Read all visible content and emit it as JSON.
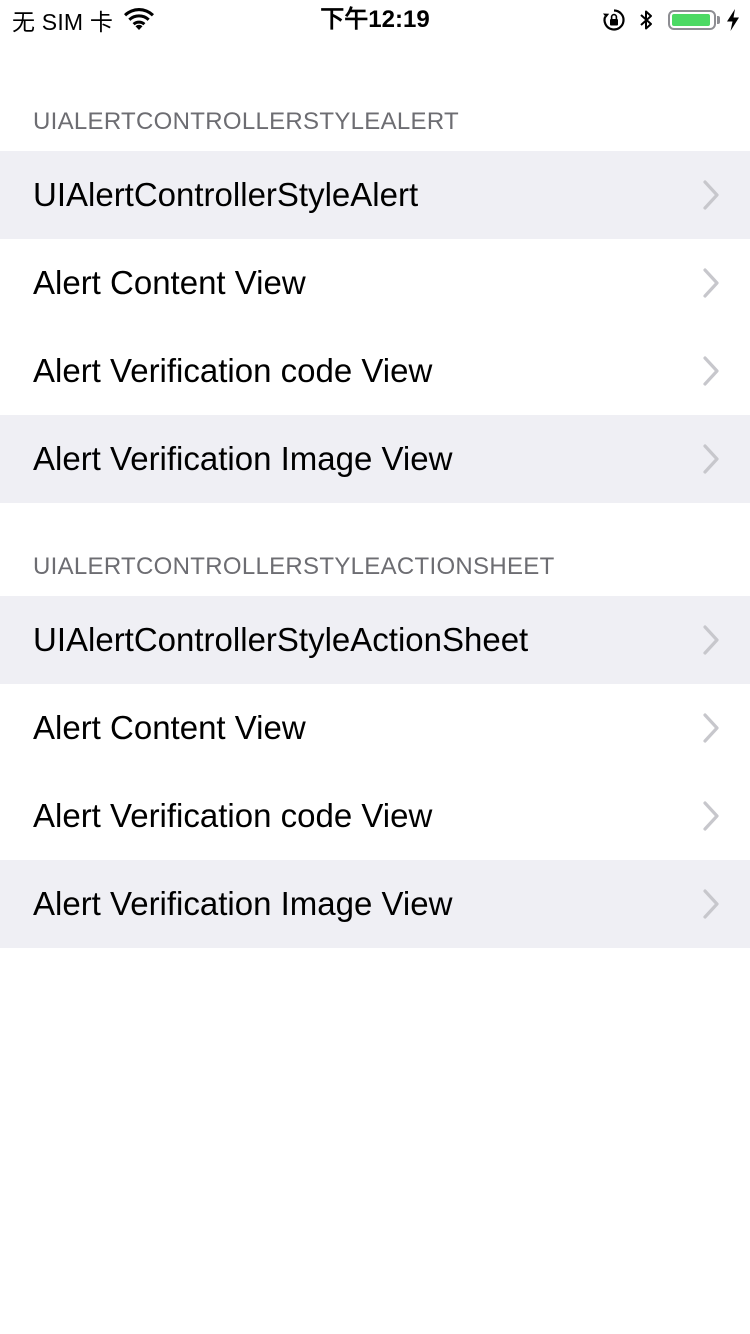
{
  "status_bar": {
    "carrier": "无 SIM 卡",
    "time": "下午12:19",
    "battery_level": 0.95,
    "icons": [
      "wifi-icon",
      "orientation-lock-icon",
      "bluetooth-icon",
      "battery-icon",
      "charging-bolt-icon"
    ]
  },
  "colors": {
    "highlight_row": "#efeff4",
    "section_header_text": "#6d6d72",
    "chevron": "#c7c7cc",
    "battery_fill": "#4cd964"
  },
  "sections": [
    {
      "header": "UIAlertControllerStyleAlert",
      "rows": [
        {
          "label": "UIAlertControllerStyleAlert",
          "highlighted": true
        },
        {
          "label": "Alert Content View",
          "highlighted": false
        },
        {
          "label": "Alert Verification code View",
          "highlighted": false
        },
        {
          "label": "Alert Verification Image View",
          "highlighted": true
        }
      ]
    },
    {
      "header": "UIAlertControllerStyleActionSheet",
      "rows": [
        {
          "label": "UIAlertControllerStyleActionSheet",
          "highlighted": true
        },
        {
          "label": "Alert Content View",
          "highlighted": false
        },
        {
          "label": "Alert Verification code View",
          "highlighted": false
        },
        {
          "label": "Alert Verification Image View",
          "highlighted": true
        }
      ]
    }
  ]
}
